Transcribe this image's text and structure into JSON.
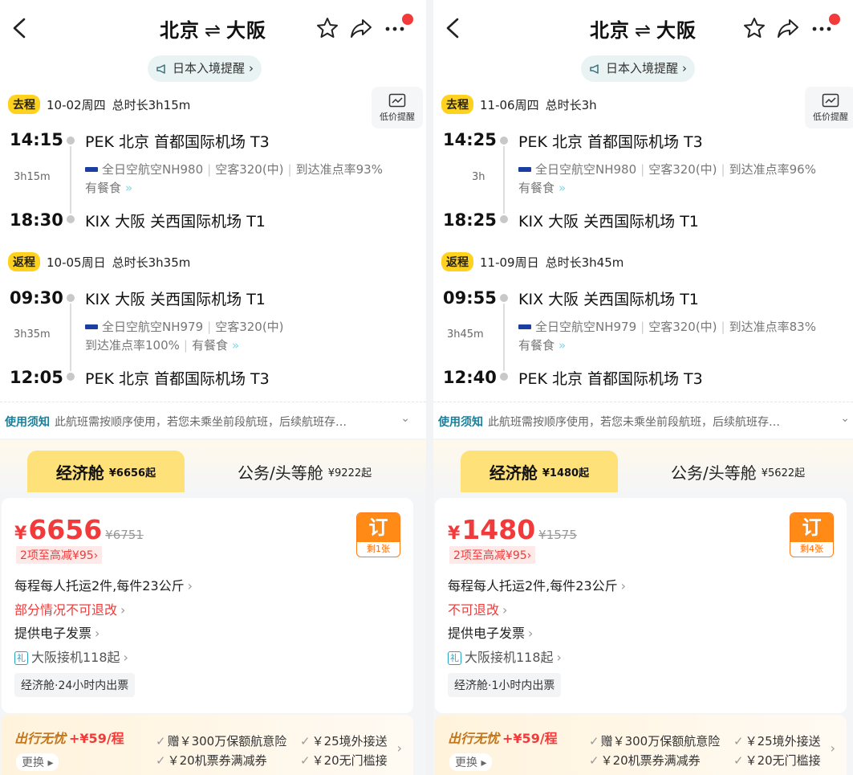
{
  "panels": [
    {
      "title_from": "北京",
      "title_to": "大阪",
      "title_arrow": "⇌",
      "notice": "日本入境提醒",
      "price_alert": "低价提醒",
      "outbound": {
        "tag": "去程",
        "date": "10-02周四",
        "total": "总时长3h15m",
        "dep_time": "14:15",
        "dep_airport": "PEK 北京 首都国际机场 T3",
        "duration": "3h15m",
        "airline": "全日空航空NH980",
        "aircraft": "空客320(中)",
        "ontime": "到达准点率93%",
        "meal": "有餐食",
        "arr_time": "18:30",
        "arr_airport": "KIX 大阪 关西国际机场 T1"
      },
      "return": {
        "tag": "返程",
        "date": "10-05周日",
        "total": "总时长3h35m",
        "dep_time": "09:30",
        "dep_airport": "KIX 大阪 关西国际机场 T1",
        "duration": "3h35m",
        "airline": "全日空航空NH979",
        "aircraft": "空客320(中)",
        "ontime": "到达准点率100%",
        "meal": "有餐食",
        "arr_time": "12:05",
        "arr_airport": "PEK 北京 首都国际机场 T3"
      },
      "usage_label": "使用须知",
      "usage_text": "此航班需按顺序使用，若您未乘坐前段航班，后续航班存…",
      "economy": {
        "label": "经济舱",
        "price": "¥6656起"
      },
      "business": {
        "label": "公务/头等舱",
        "price": "¥9222起"
      },
      "price_symbol": "¥",
      "price": "6656",
      "orig_price": "¥6751",
      "discount": "2项至高减¥95",
      "book": "订",
      "remaining": "剩1张",
      "baggage": "每程每人托运2件,每件23公斤",
      "refund": "部分情况不可退改",
      "invoice": "提供电子发票",
      "gift_icon": "礼",
      "transfer": "大阪接机118起",
      "ticketing": "经济舱·24小时内出票",
      "ins_title": "出行无忧",
      "ins_price": "+¥59/程",
      "ins_change": "更换",
      "ins_b1": "赠￥300万保额航意险",
      "ins_b2": "￥25境外接送",
      "ins_b3": "￥20机票券满减券",
      "ins_b4": "￥20无门槛接"
    },
    {
      "title_from": "北京",
      "title_to": "大阪",
      "title_arrow": "⇌",
      "notice": "日本入境提醒",
      "price_alert": "低价提醒",
      "outbound": {
        "tag": "去程",
        "date": "11-06周四",
        "total": "总时长3h",
        "dep_time": "14:25",
        "dep_airport": "PEK 北京 首都国际机场 T3",
        "duration": "3h",
        "airline": "全日空航空NH980",
        "aircraft": "空客320(中)",
        "ontime": "到达准点率96%",
        "meal": "有餐食",
        "arr_time": "18:25",
        "arr_airport": "KIX 大阪 关西国际机场 T1"
      },
      "return": {
        "tag": "返程",
        "date": "11-09周日",
        "total": "总时长3h45m",
        "dep_time": "09:55",
        "dep_airport": "KIX 大阪 关西国际机场 T1",
        "duration": "3h45m",
        "airline": "全日空航空NH979",
        "aircraft": "空客320(中)",
        "ontime": "到达准点率83%",
        "meal": "有餐食",
        "arr_time": "12:40",
        "arr_airport": "PEK 北京 首都国际机场 T3"
      },
      "usage_label": "使用须知",
      "usage_text": "此航班需按顺序使用，若您未乘坐前段航班，后续航班存…",
      "economy": {
        "label": "经济舱",
        "price": "¥1480起"
      },
      "business": {
        "label": "公务/头等舱",
        "price": "¥5622起"
      },
      "price_symbol": "¥",
      "price": "1480",
      "orig_price": "¥1575",
      "discount": "2项至高减¥95",
      "book": "订",
      "remaining": "剩4张",
      "baggage": "每程每人托运2件,每件23公斤",
      "refund": "不可退改",
      "invoice": "提供电子发票",
      "gift_icon": "礼",
      "transfer": "大阪接机118起",
      "ticketing": "经济舱·1小时内出票",
      "ins_title": "出行无忧",
      "ins_price": "+¥59/程",
      "ins_change": "更换",
      "ins_b1": "赠￥300万保额航意险",
      "ins_b2": "￥25境外接送",
      "ins_b3": "￥20机票券满减券",
      "ins_b4": "￥20无门槛接"
    }
  ],
  "colors": {
    "accent_red": "#f23a3a",
    "tag_yellow": "#ffd21f",
    "book_orange": "#ff8a16"
  }
}
